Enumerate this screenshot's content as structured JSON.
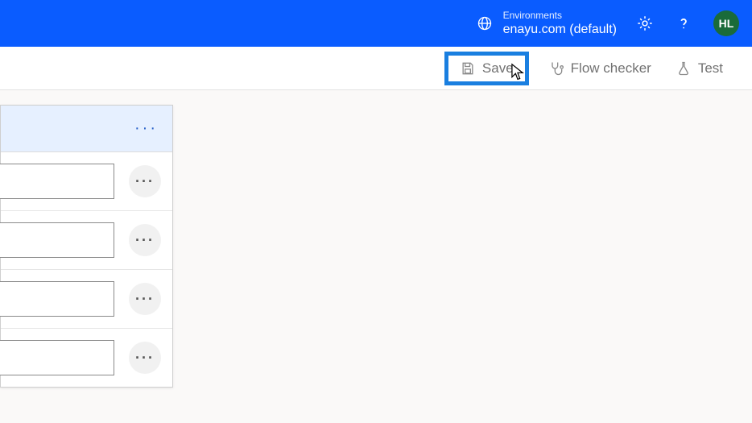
{
  "header": {
    "env_label": "Environments",
    "env_name": "enayu.com (default)",
    "avatar_initials": "HL"
  },
  "toolbar": {
    "save_label": "Save",
    "flow_checker_label": "Flow checker",
    "test_label": "Test"
  },
  "card": {
    "rows": [
      {
        "value": ""
      },
      {
        "value": ""
      },
      {
        "value": ")"
      },
      {
        "value": ""
      }
    ]
  }
}
